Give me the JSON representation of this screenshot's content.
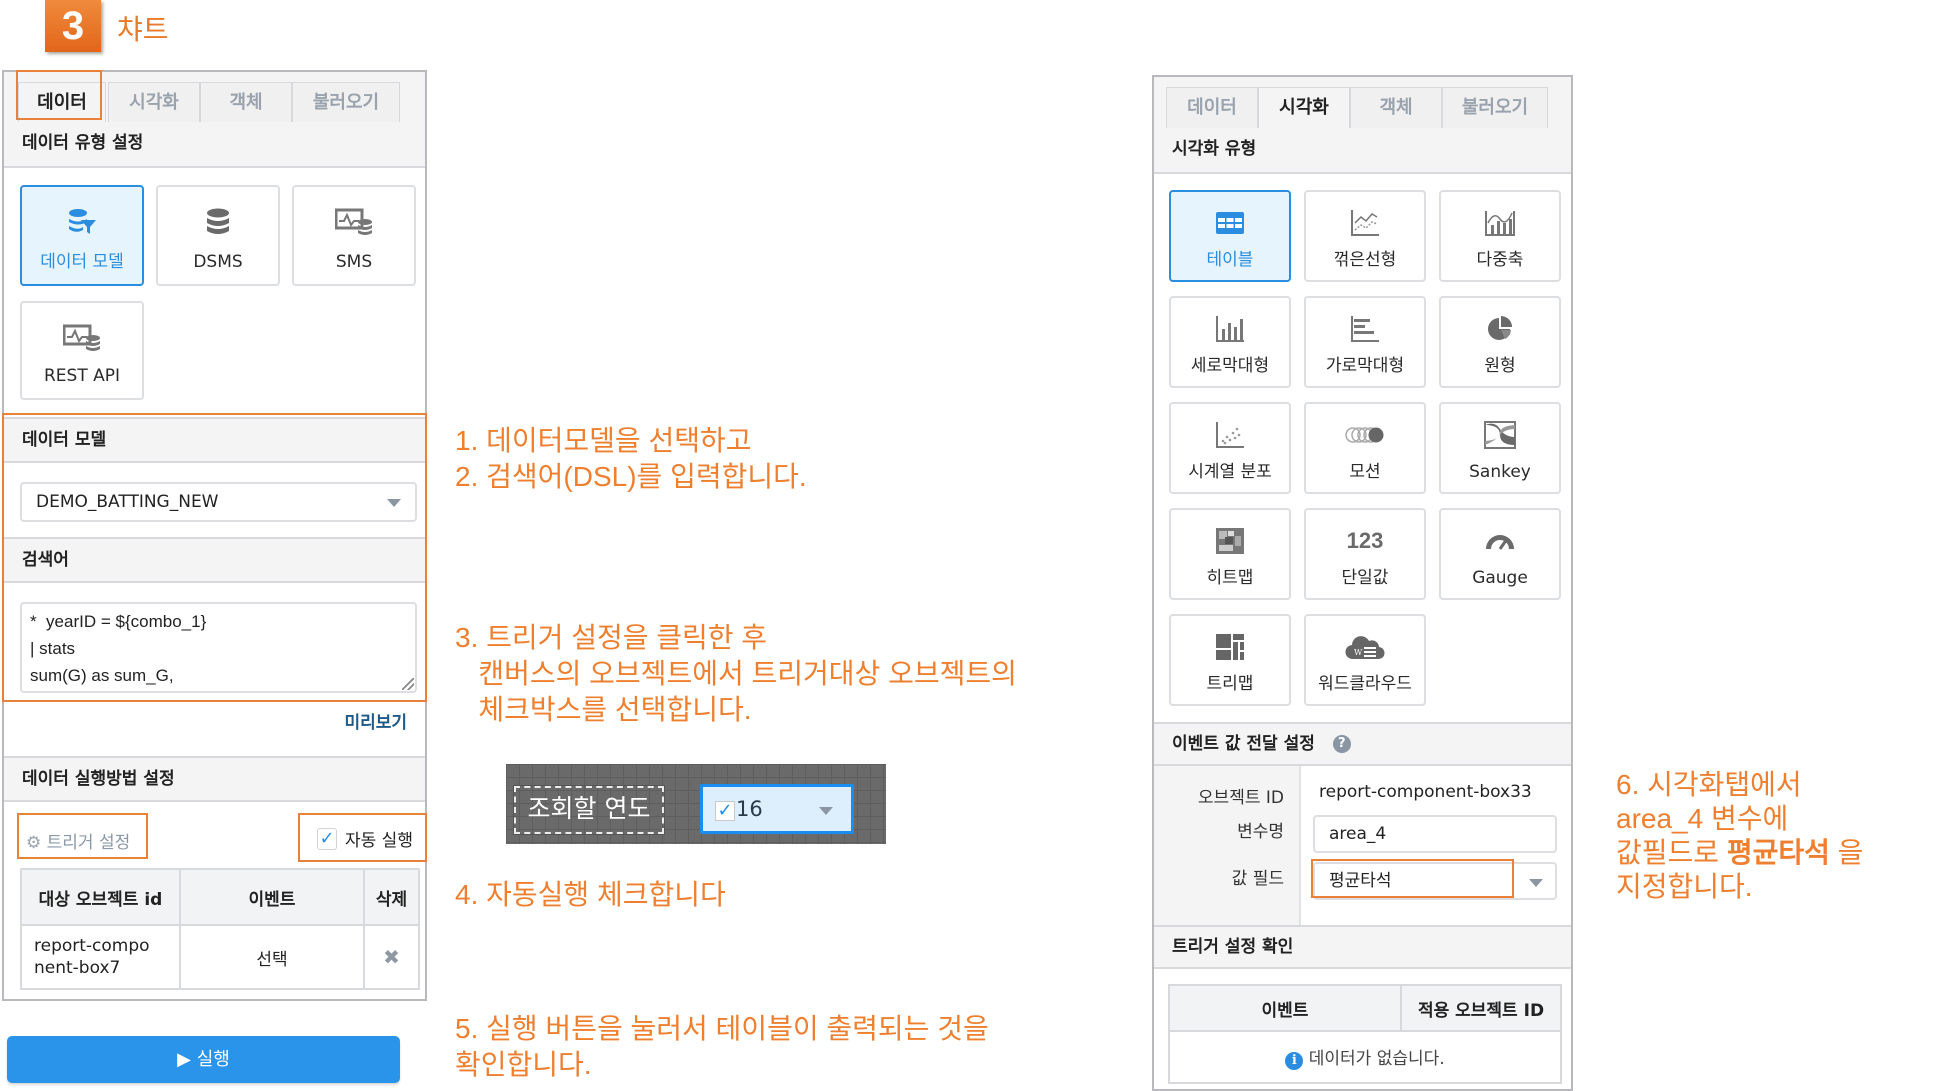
{
  "header": {
    "step_number": "3",
    "title": "챠트"
  },
  "left_panel": {
    "tabs": [
      {
        "label": "데이터",
        "active": true
      },
      {
        "label": "시각화",
        "active": false
      },
      {
        "label": "객체",
        "active": false
      },
      {
        "label": "불러오기",
        "active": false
      }
    ],
    "data_type_section": "데이터 유형 설정",
    "data_types": [
      {
        "label": "데이터 모델",
        "icon": "data-model-filter-icon",
        "selected": true
      },
      {
        "label": "DSMS",
        "icon": "database-icon",
        "selected": false
      },
      {
        "label": "SMS",
        "icon": "monitor-database-icon",
        "selected": false
      },
      {
        "label": "REST API",
        "icon": "monitor-database-icon",
        "selected": false
      }
    ],
    "data_model_section": "데이터 모델",
    "data_model_value": "DEMO_BATTING_NEW",
    "query_section": "검색어",
    "query_text": "*  yearID = ${combo_1}\n| stats\nsum(G) as sum_G,",
    "preview_label": "미리보기",
    "exec_section": "데이터 실행방법 설정",
    "trigger_label": "트리거 설정",
    "auto_run_label": "자동 실행",
    "auto_run_checked": true,
    "table": {
      "headers": [
        "대상 오브젝트 id",
        "이벤트",
        "삭제"
      ],
      "rows": [
        {
          "target": "report-compo\nnent-box7",
          "event": "선택",
          "delete": "✖"
        }
      ]
    },
    "run_label": "실행"
  },
  "notes": {
    "n1": "1. 데이터모델을 선택하고\n2. 검색어(DSL)를 입력합니다.",
    "n3": "3. 트리거 설정을 클릭한 후\n   캔버스의 오브젝트에서 트리거대상 오브젝트의\n   체크박스를 선택합니다.",
    "n4": "4. 자동실행 체크합니다",
    "n5": "5. 실행 버튼을 눌러서 테이블이 출력되는 것을\n확인합니다.",
    "n6_line1": "6. 시각화탭에서",
    "n6_line2": "area_4 변수에",
    "n6_line3a": "값필드로 ",
    "n6_line3b": "평균타석",
    "n6_line3c": " 을",
    "n6_line4": "지정합니다."
  },
  "canvas_example": {
    "label": "조회할 연도",
    "combo_value": "16",
    "checked": true
  },
  "right_panel": {
    "tabs": [
      {
        "label": "데이터",
        "active": false
      },
      {
        "label": "시각화",
        "active": true
      },
      {
        "label": "객체",
        "active": false
      },
      {
        "label": "불러오기",
        "active": false
      }
    ],
    "vis_section": "시각화 유형",
    "vis_types": [
      {
        "label": "테이블",
        "icon": "table-icon",
        "selected": true
      },
      {
        "label": "꺾은선형",
        "icon": "line-chart-icon",
        "selected": false
      },
      {
        "label": "다중축",
        "icon": "multi-axis-chart-icon",
        "selected": false
      },
      {
        "label": "세로막대형",
        "icon": "column-chart-icon",
        "selected": false
      },
      {
        "label": "가로막대형",
        "icon": "bar-chart-icon",
        "selected": false
      },
      {
        "label": "원형",
        "icon": "pie-chart-icon",
        "selected": false
      },
      {
        "label": "시계열 분포",
        "icon": "scatter-chart-icon",
        "selected": false
      },
      {
        "label": "모션",
        "icon": "motion-icon",
        "selected": false
      },
      {
        "label": "Sankey",
        "icon": "sankey-icon",
        "selected": false
      },
      {
        "label": "히트맵",
        "icon": "heatmap-icon",
        "selected": false
      },
      {
        "label": "단일값",
        "icon": "single-value-icon",
        "selected": false
      },
      {
        "label": "Gauge",
        "icon": "gauge-icon",
        "selected": false
      },
      {
        "label": "트리맵",
        "icon": "treemap-icon",
        "selected": false
      },
      {
        "label": "워드클라우드",
        "icon": "word-cloud-icon",
        "selected": false
      }
    ],
    "single_value_glyph": "123",
    "event_section": "이벤트 값 전달 설정",
    "object_id_label": "오브젝트 ID",
    "object_id_value": "report-component-box33",
    "var_label": "변수명",
    "var_value": "area_4",
    "field_label": "값 필드",
    "field_value": "평균타석",
    "trigger_check_section": "트리거 설정 확인",
    "table_headers": [
      "이벤트",
      "적용 오브젝트 ID"
    ],
    "empty_text": "데이터가 없습니다."
  },
  "colors": {
    "accent_orange": "#e8823a",
    "accent_blue": "#2a8de0",
    "run_button": "#2a93ea"
  }
}
